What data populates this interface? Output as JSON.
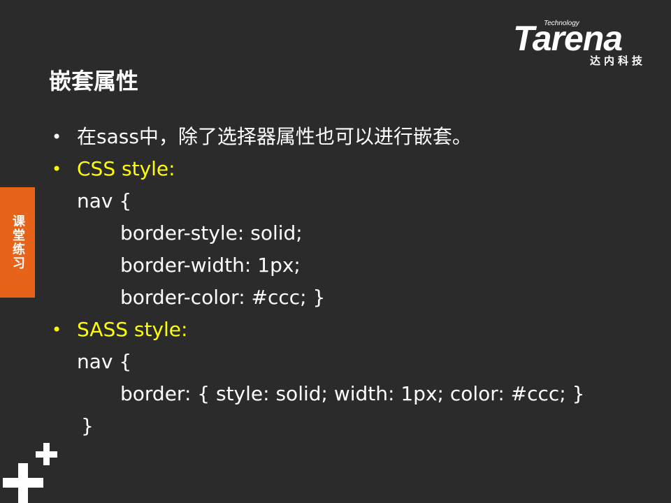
{
  "brand": {
    "tech": "Technology",
    "name": "Tarena",
    "cn": "达内科技"
  },
  "title": "嵌套属性",
  "side_tab": "课堂练习",
  "lines": [
    "在sass中，除了选择器属性也可以进行嵌套。",
    "CSS style:",
    "nav {",
    "border-style: solid;",
    "border-width: 1px;",
    "border-color: #ccc; }",
    "SASS style:",
    "nav {",
    "border: { style: solid; width: 1px; color: #ccc; }",
    "}"
  ],
  "bullet_char": "•",
  "colors": {
    "background": "#2b2b2b",
    "accent": "#ffff00",
    "tab": "#e8631a",
    "text": "#ffffff"
  }
}
